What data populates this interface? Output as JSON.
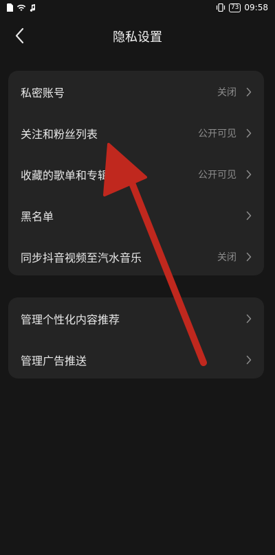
{
  "status_bar": {
    "time": "09:58",
    "battery": "73",
    "icons": [
      "sim-icon",
      "wifi-icon",
      "music-note-icon",
      "vibrate-icon"
    ]
  },
  "header": {
    "title": "隐私设置",
    "back_icon": "back-arrow-icon"
  },
  "privacy_group": {
    "items": [
      {
        "label": "私密账号",
        "value": "关闭"
      },
      {
        "label": "关注和粉丝列表",
        "value": "公开可见"
      },
      {
        "label": "收藏的歌单和专辑",
        "value": "公开可见"
      },
      {
        "label": "黑名单",
        "value": ""
      },
      {
        "label": "同步抖音视频至汽水音乐",
        "value": "关闭"
      }
    ]
  },
  "content_group": {
    "items": [
      {
        "label": "管理个性化内容推荐",
        "value": ""
      },
      {
        "label": "管理广告推送",
        "value": ""
      }
    ]
  },
  "colors": {
    "background": "#161616",
    "card": "#242424",
    "annotation_arrow": "#c0281e"
  }
}
